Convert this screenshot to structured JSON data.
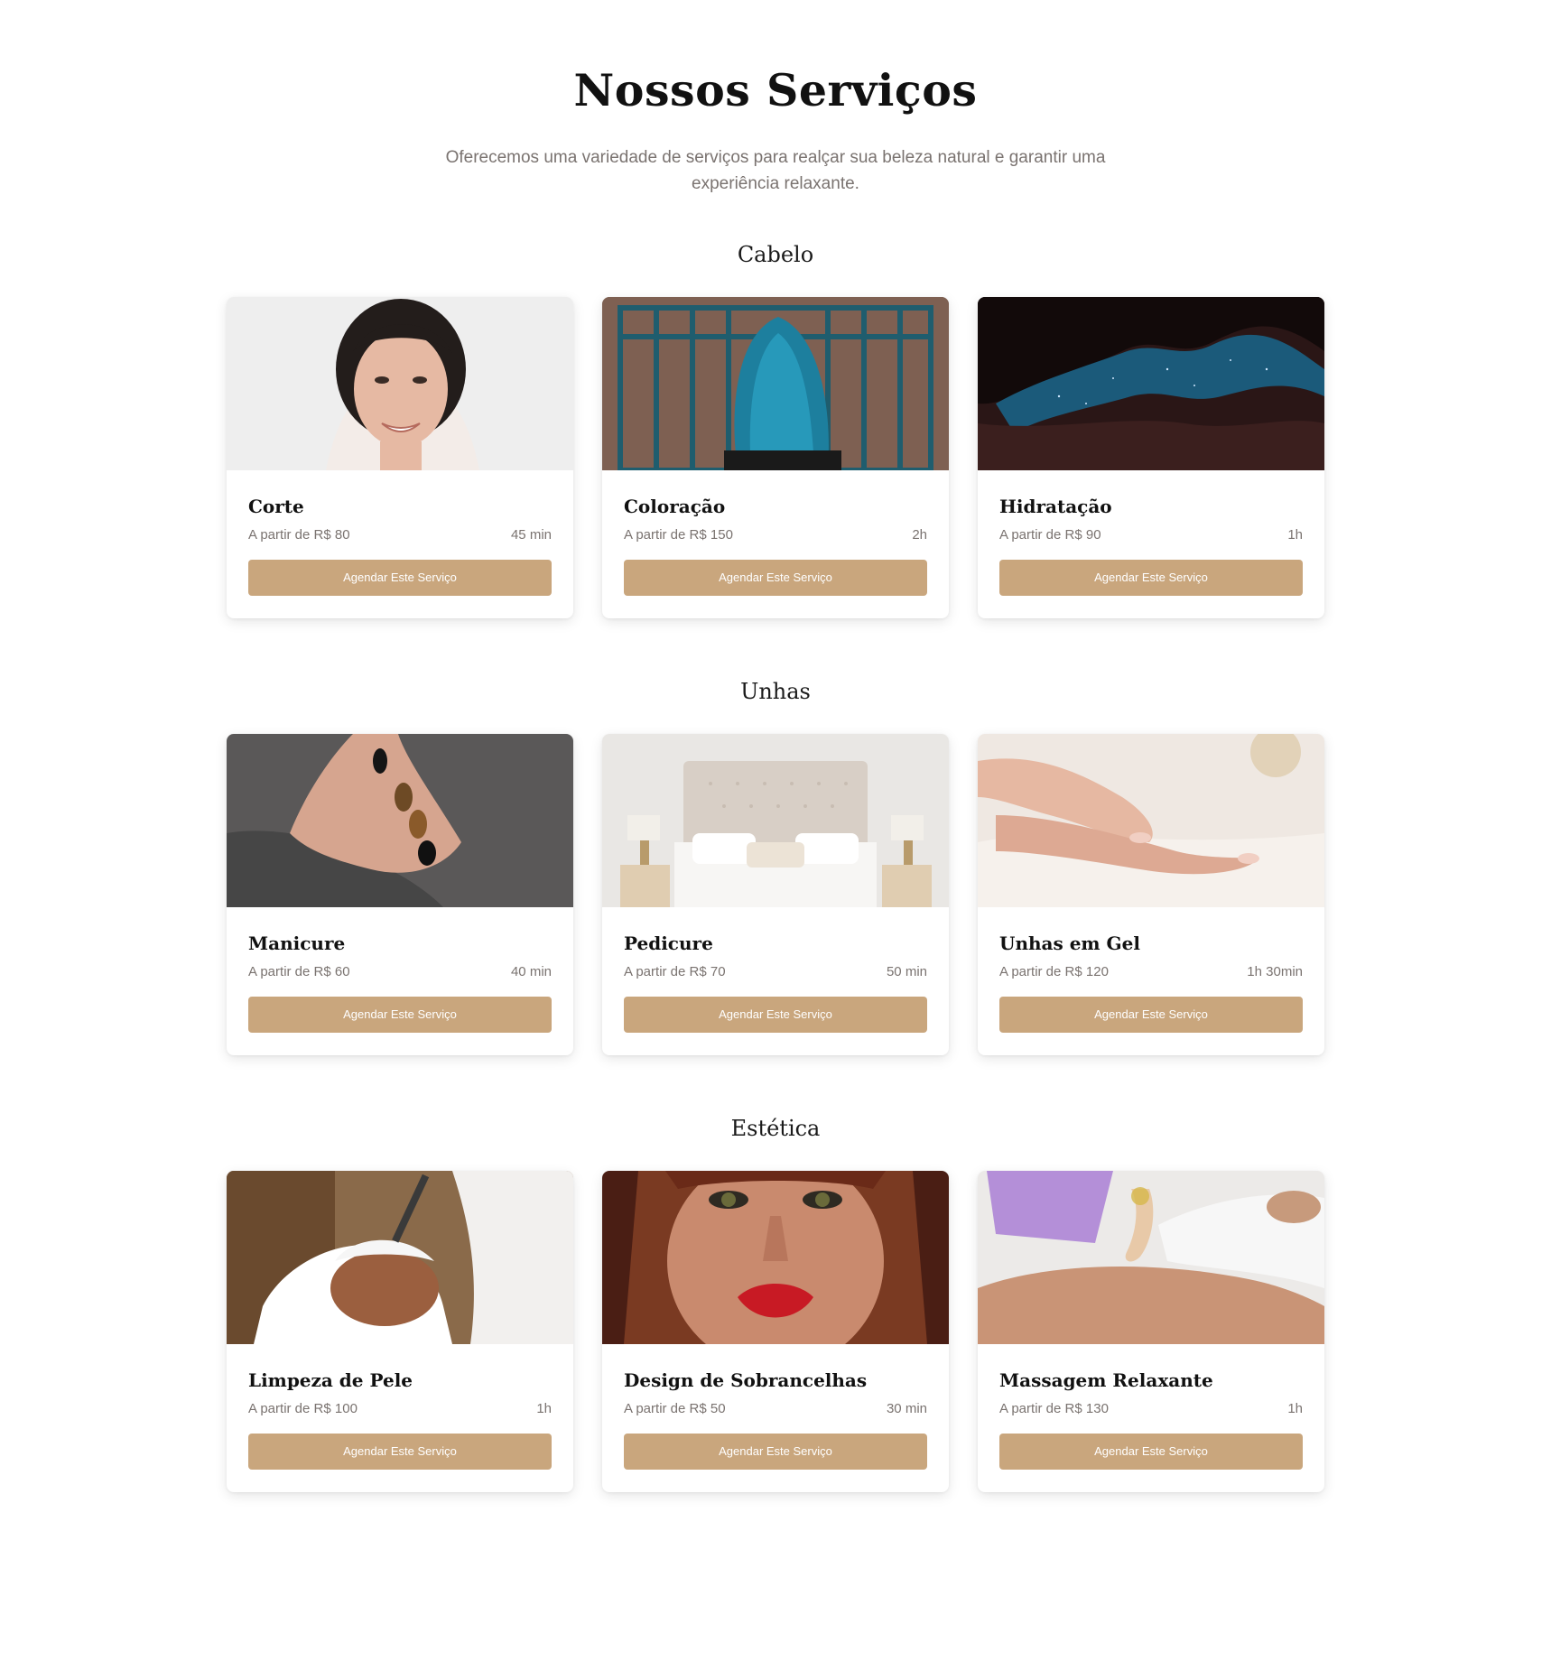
{
  "header": {
    "title": "Nossos Serviços",
    "intro": "Oferecemos uma variedade de serviços para realçar sua beleza natural e garantir uma experiência relaxante."
  },
  "categories": [
    {
      "name": "Cabelo",
      "services": [
        {
          "title": "Corte",
          "price": "A partir de R$ 80",
          "duration": "45 min",
          "button": "Agendar Este Serviço",
          "image": "woman-portrait"
        },
        {
          "title": "Coloração",
          "price": "A partir de R$ 150",
          "duration": "2h",
          "button": "Agendar Este Serviço",
          "image": "blue-hair"
        },
        {
          "title": "Hidratação",
          "price": "A partir de R$ 90",
          "duration": "1h",
          "button": "Agendar Este Serviço",
          "image": "canyon-stars"
        }
      ]
    },
    {
      "name": "Unhas",
      "services": [
        {
          "title": "Manicure",
          "price": "A partir de R$ 60",
          "duration": "40 min",
          "button": "Agendar Este Serviço",
          "image": "manicure-hand"
        },
        {
          "title": "Pedicure",
          "price": "A partir de R$ 70",
          "duration": "50 min",
          "button": "Agendar Este Serviço",
          "image": "bedroom"
        },
        {
          "title": "Unhas em Gel",
          "price": "A partir de R$ 120",
          "duration": "1h 30min",
          "button": "Agendar Este Serviço",
          "image": "gel-nails"
        }
      ]
    },
    {
      "name": "Estética",
      "services": [
        {
          "title": "Limpeza de Pele",
          "price": "A partir de R$ 100",
          "duration": "1h",
          "button": "Agendar Este Serviço",
          "image": "facial-mask"
        },
        {
          "title": "Design de Sobrancelhas",
          "price": "A partir de R$ 50",
          "duration": "30 min",
          "button": "Agendar Este Serviço",
          "image": "red-lips-face"
        },
        {
          "title": "Massagem Relaxante",
          "price": "A partir de R$ 130",
          "duration": "1h",
          "button": "Agendar Este Serviço",
          "image": "massage-oil"
        }
      ]
    }
  ],
  "colors": {
    "accent": "#c9a67d",
    "muted_text": "#7a7370",
    "heading": "#111111",
    "background": "#ffffff"
  }
}
